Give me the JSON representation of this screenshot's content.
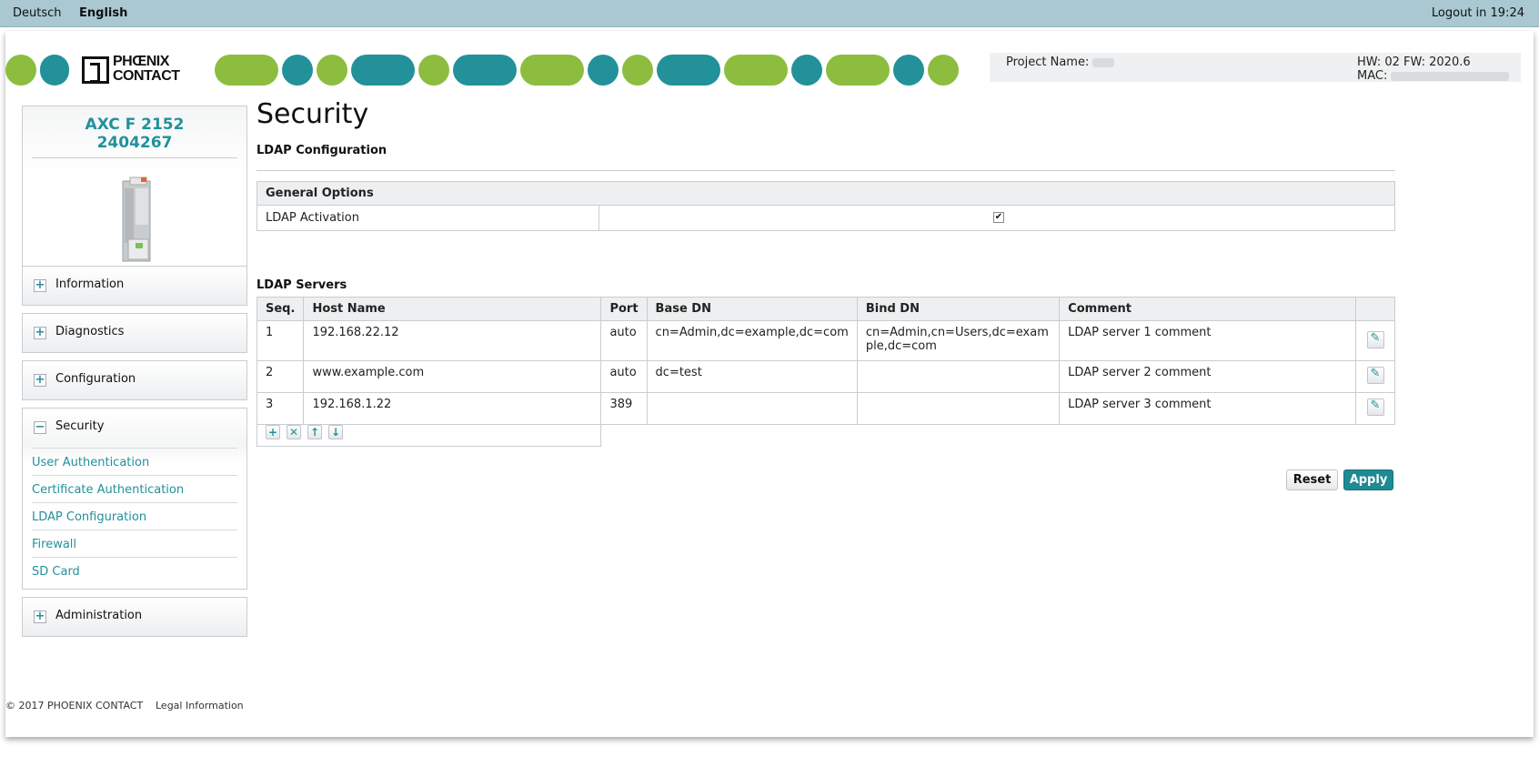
{
  "topbar": {
    "lang_de": "Deutsch",
    "lang_en": "English",
    "logout": "Logout in 19:24"
  },
  "brand": {
    "logo_line1": "PHŒNIX",
    "logo_line2": "CONTACT",
    "accent_teal": "#22919a",
    "accent_green": "#8cbd3f"
  },
  "info": {
    "project_name_label": "Project Name:",
    "hw_fw": "HW: 02 FW: 2020.6",
    "mac_label": "MAC:"
  },
  "device": {
    "name": "AXC F 2152",
    "order_no": "2404267"
  },
  "sidebar": {
    "information": "Information",
    "diagnostics": "Diagnostics",
    "configuration": "Configuration",
    "security": "Security",
    "security_items": [
      "User Authentication",
      "Certificate Authentication",
      "LDAP Configuration",
      "Firewall",
      "SD Card"
    ],
    "administration": "Administration",
    "toggle_plus": "+",
    "toggle_minus": "−"
  },
  "page": {
    "title": "Security",
    "subtitle": "LDAP Configuration"
  },
  "general_options": {
    "header": "General Options",
    "ldap_activation_label": "LDAP Activation",
    "ldap_activation_checked": true,
    "check_mark": "✔"
  },
  "ldap_servers": {
    "title": "LDAP Servers",
    "columns": [
      "Seq.",
      "Host Name",
      "Port",
      "Base DN",
      "Bind DN",
      "Comment"
    ],
    "rows": [
      {
        "seq": "1",
        "host": "192.168.22.12",
        "port": "auto",
        "base_dn": "cn=Admin,dc=example,dc=com",
        "bind_dn": "cn=Admin,cn=Users,dc=example,dc=com",
        "comment": "LDAP server 1 comment"
      },
      {
        "seq": "2",
        "host": "www.example.com",
        "port": "auto",
        "base_dn": "dc=test",
        "bind_dn": "",
        "comment": "LDAP server 2 comment"
      },
      {
        "seq": "3",
        "host": "192.168.1.22",
        "port": "389",
        "base_dn": "",
        "bind_dn": "",
        "comment": "LDAP server 3 comment"
      }
    ],
    "tool_icons": [
      "add-icon",
      "delete-icon",
      "move-up-icon",
      "move-down-icon"
    ]
  },
  "actions": {
    "reset": "Reset",
    "apply": "Apply"
  },
  "footer": {
    "copyright": "© 2017 PHOENIX CONTACT",
    "legal": "Legal Information"
  }
}
